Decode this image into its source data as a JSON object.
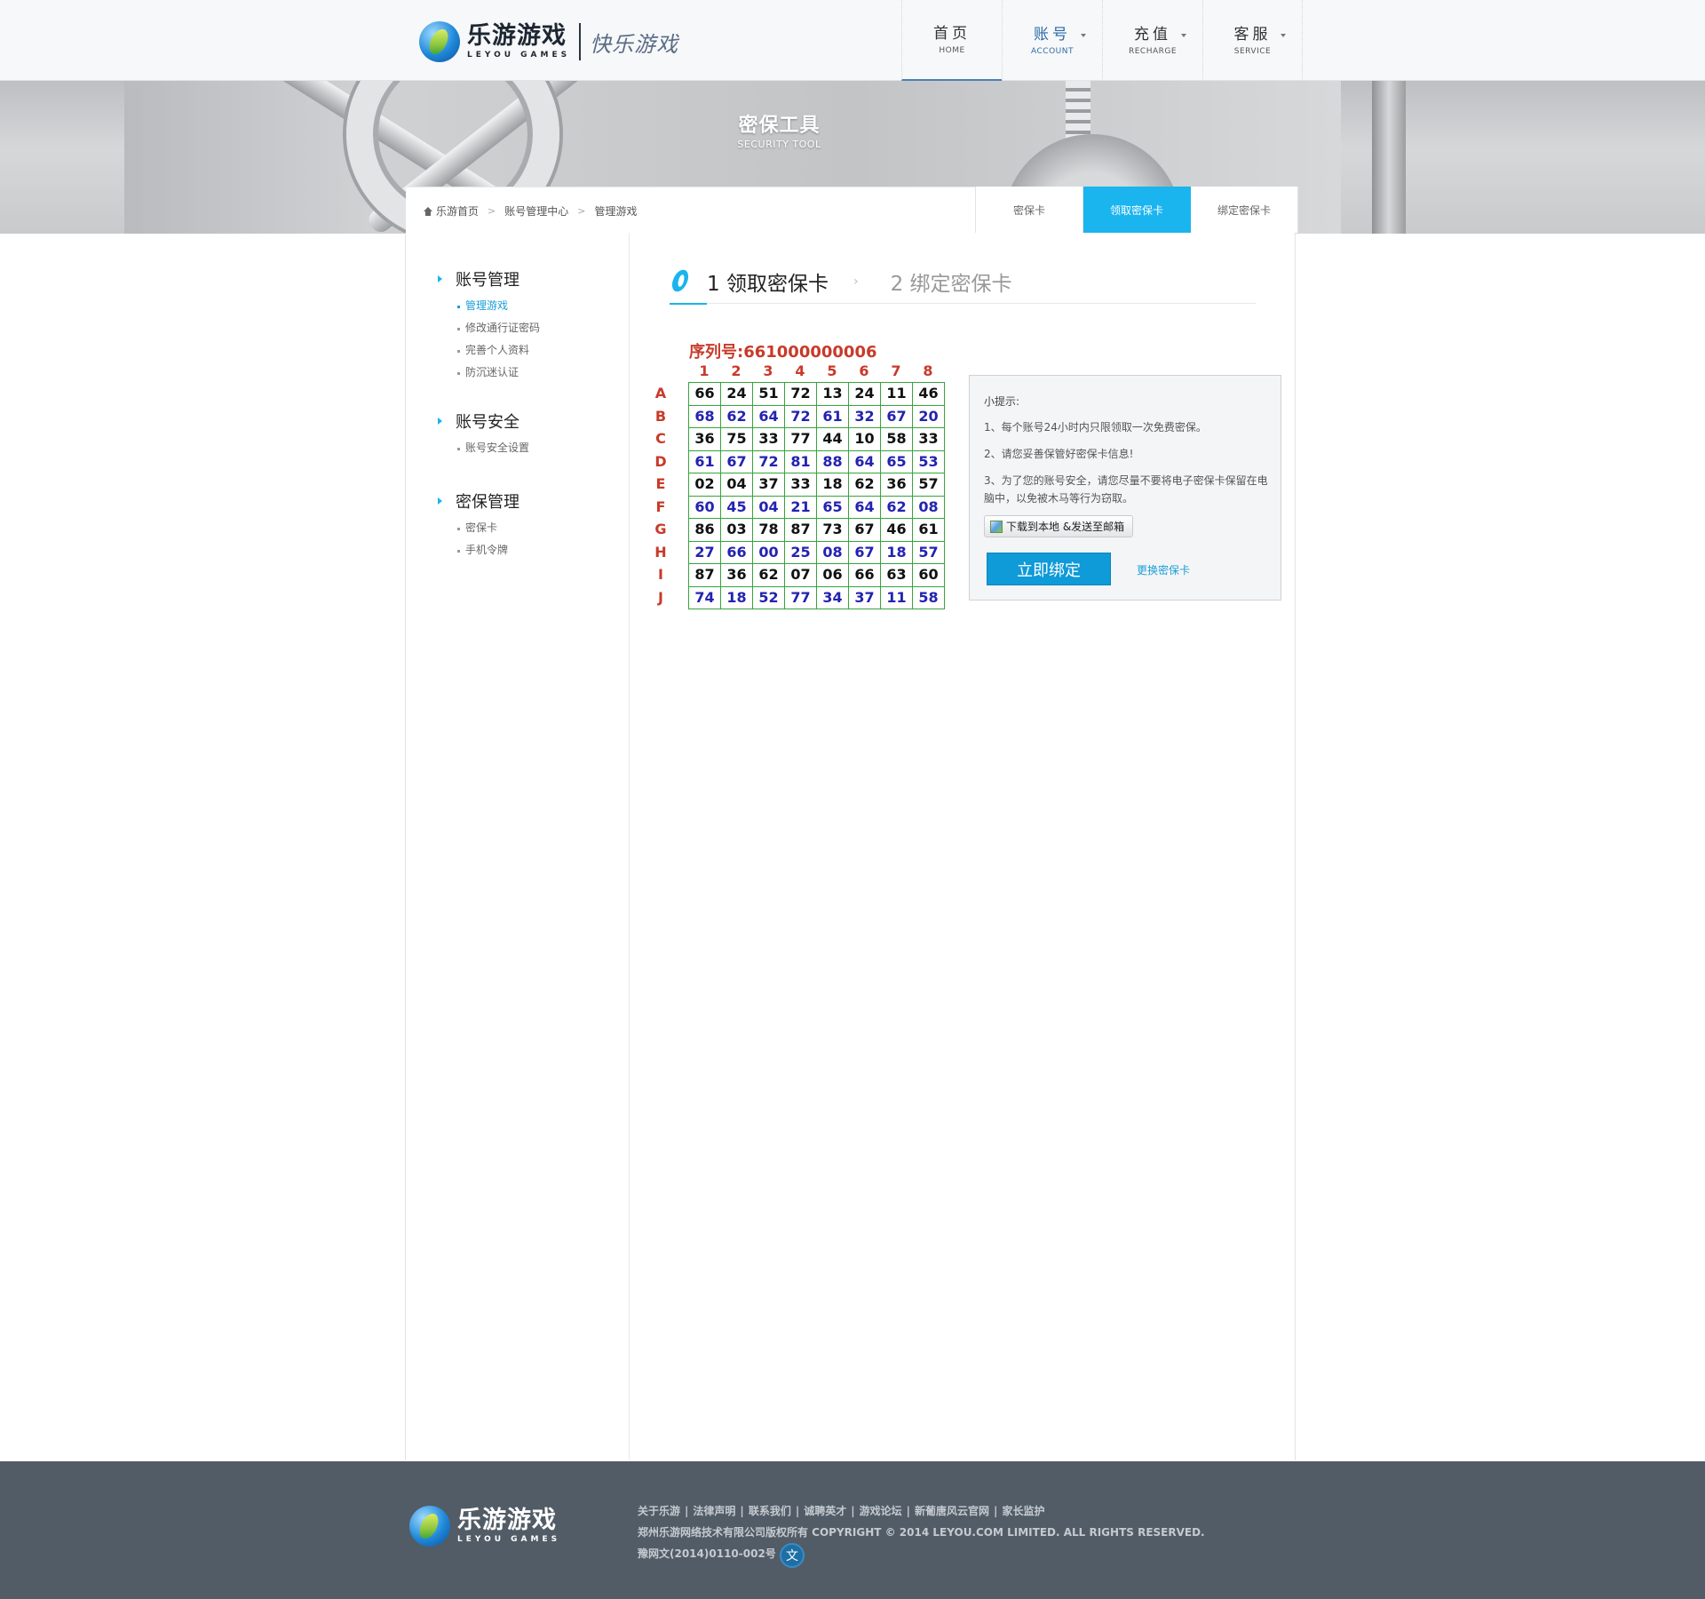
{
  "header": {
    "logo_cn": "乐游游戏",
    "logo_en": "LEYOU GAMES",
    "slogan": "快乐游戏",
    "nav": [
      {
        "cn": "首页",
        "en": "HOME"
      },
      {
        "cn": "账号",
        "en": "ACCOUNT"
      },
      {
        "cn": "充值",
        "en": "RECHARGE"
      },
      {
        "cn": "客服",
        "en": "SERVICE"
      }
    ]
  },
  "banner": {
    "title": "密保工具",
    "subtitle": "SECURITY TOOL"
  },
  "breadcrumb": [
    "乐游首页",
    "账号管理中心",
    "管理游戏"
  ],
  "subtabs": [
    "密保卡",
    "领取密保卡",
    "绑定密保卡"
  ],
  "sidebar": {
    "groups": [
      {
        "title": "账号管理",
        "links": [
          "管理游戏",
          "修改通行证密码",
          "完善个人资料",
          "防沉迷认证"
        ]
      },
      {
        "title": "账号安全",
        "links": [
          "账号安全设置"
        ]
      },
      {
        "title": "密保管理",
        "links": [
          "密保卡",
          "手机令牌"
        ]
      }
    ]
  },
  "steps": {
    "step1": "1 领取密保卡",
    "arrow": "›",
    "step2": "2 绑定密保卡"
  },
  "card": {
    "serial": "序列号:661000000006",
    "columns": [
      "1",
      "2",
      "3",
      "4",
      "5",
      "6",
      "7",
      "8"
    ],
    "rows": [
      "A",
      "B",
      "C",
      "D",
      "E",
      "F",
      "G",
      "H",
      "I",
      "J"
    ],
    "values": [
      [
        "66",
        "24",
        "51",
        "72",
        "13",
        "24",
        "11",
        "46"
      ],
      [
        "68",
        "62",
        "64",
        "72",
        "61",
        "32",
        "67",
        "20"
      ],
      [
        "36",
        "75",
        "33",
        "77",
        "44",
        "10",
        "58",
        "33"
      ],
      [
        "61",
        "67",
        "72",
        "81",
        "88",
        "64",
        "65",
        "53"
      ],
      [
        "02",
        "04",
        "37",
        "33",
        "18",
        "62",
        "36",
        "57"
      ],
      [
        "60",
        "45",
        "04",
        "21",
        "65",
        "64",
        "62",
        "08"
      ],
      [
        "86",
        "03",
        "78",
        "87",
        "73",
        "67",
        "46",
        "61"
      ],
      [
        "27",
        "66",
        "00",
        "25",
        "08",
        "67",
        "18",
        "57"
      ],
      [
        "87",
        "36",
        "62",
        "07",
        "06",
        "66",
        "63",
        "60"
      ],
      [
        "74",
        "18",
        "52",
        "77",
        "34",
        "37",
        "11",
        "58"
      ]
    ],
    "colors": {
      "label": "#c83a2a",
      "odd_row": "#111111",
      "even_row": "#2323b0",
      "grid": "#37a43a"
    }
  },
  "tips": {
    "title": "小提示:",
    "lines": [
      "1、每个账号24小时内只限领取一次免费密保。",
      "2、请您妥善保管好密保卡信息!",
      "3、为了您的账号安全，请您尽量不要将电子密保卡保留在电脑中，以免被木马等行为窃取。"
    ],
    "download_label": "下载到本地 &发送至邮箱",
    "bind_label": "立即绑定",
    "change_label": "更换密保卡"
  },
  "footer": {
    "links": [
      "关于乐游",
      "法律声明",
      "联系我们",
      "诚聘英才",
      "游戏论坛",
      "新葡唐风云官网",
      "家长监护"
    ],
    "copyright": "郑州乐游网络技术有限公司版权所有 COPYRIGHT © 2014 LEYOU.COM LIMITED. ALL RIGHTS RESERVED.",
    "license": "豫网文(2014)0110-002号",
    "badge": "文"
  },
  "colors": {
    "accent": "#1ab4ef",
    "footer_bg": "#525c66",
    "nav_active": "#2d6aa8"
  }
}
